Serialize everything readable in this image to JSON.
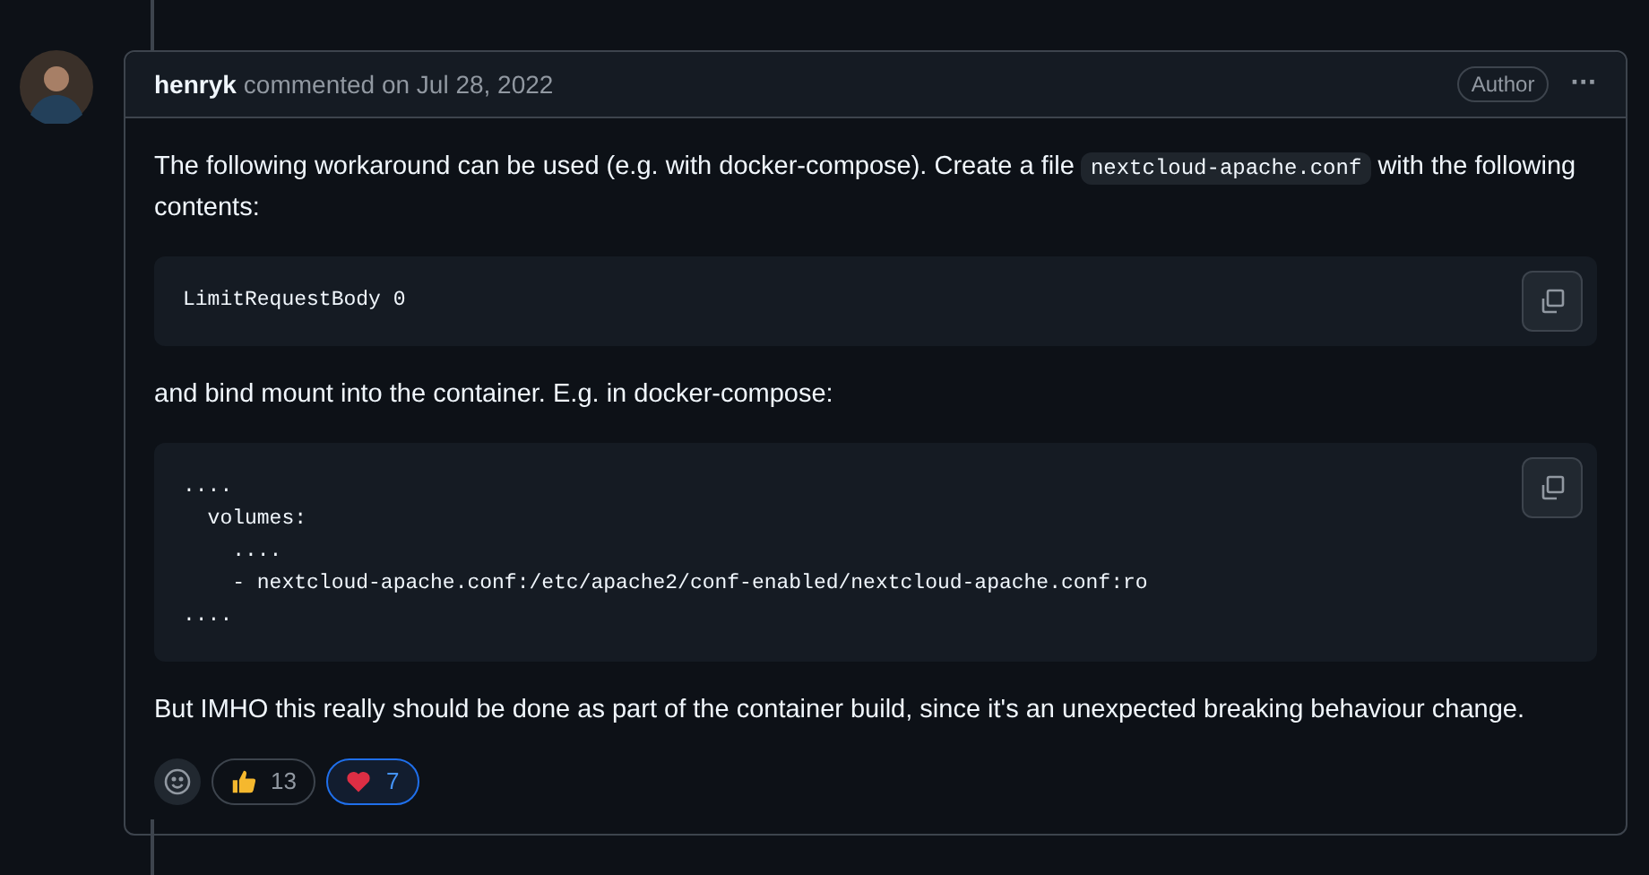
{
  "comment": {
    "author": "henryk",
    "meta": "commented on Jul 28, 2022",
    "badge": "Author",
    "menu": "···",
    "body": [
      {
        "kind": "paragraph",
        "parts": [
          {
            "kind": "text",
            "text": "The following workaround can be used (e.g. with docker-compose). Create a file"
          },
          {
            "kind": "code",
            "text": "nextcloud-apache.conf"
          },
          {
            "kind": "text",
            "text": "with the following"
          },
          {
            "kind": "text",
            "text": "contents:"
          }
        ]
      },
      {
        "kind": "codeblock",
        "code": "LimitRequestBody 0"
      },
      {
        "kind": "paragraph",
        "parts": [
          {
            "kind": "text",
            "text": "and bind mount into the container. E.g. in docker-compose:"
          }
        ]
      },
      {
        "kind": "codeblock",
        "code": "....\n  volumes:\n    ....\n    - nextcloud-apache.conf:/etc/apache2/conf-enabled/nextcloud-apache.conf:ro\n...."
      },
      {
        "kind": "paragraph",
        "parts": [
          {
            "kind": "text",
            "text": "But IMHO this really should be done as part of the container build, since it's an unexpected breaking behaviour change."
          }
        ]
      }
    ],
    "reactions": [
      {
        "kind": "thumbs",
        "count": "13",
        "selected": false
      },
      {
        "kind": "heart",
        "count": "7",
        "selected": true
      }
    ]
  }
}
